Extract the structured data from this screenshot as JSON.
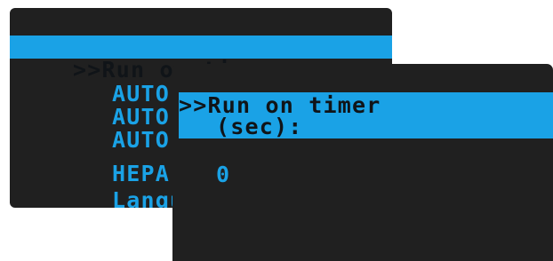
{
  "menu": {
    "selected_item": ">>Run on timer",
    "items": [
      "AUTO cl",
      "AUTO pl",
      "AUTO pl",
      "HEPA-fi",
      "Languag"
    ]
  },
  "timer": {
    "title_line1": ">>Run on timer",
    "title_line2": "(sec):",
    "value": "0"
  },
  "colors": {
    "accent": "#1aa2e6",
    "screen_bg": "#202020",
    "selected_text": "#101418"
  }
}
